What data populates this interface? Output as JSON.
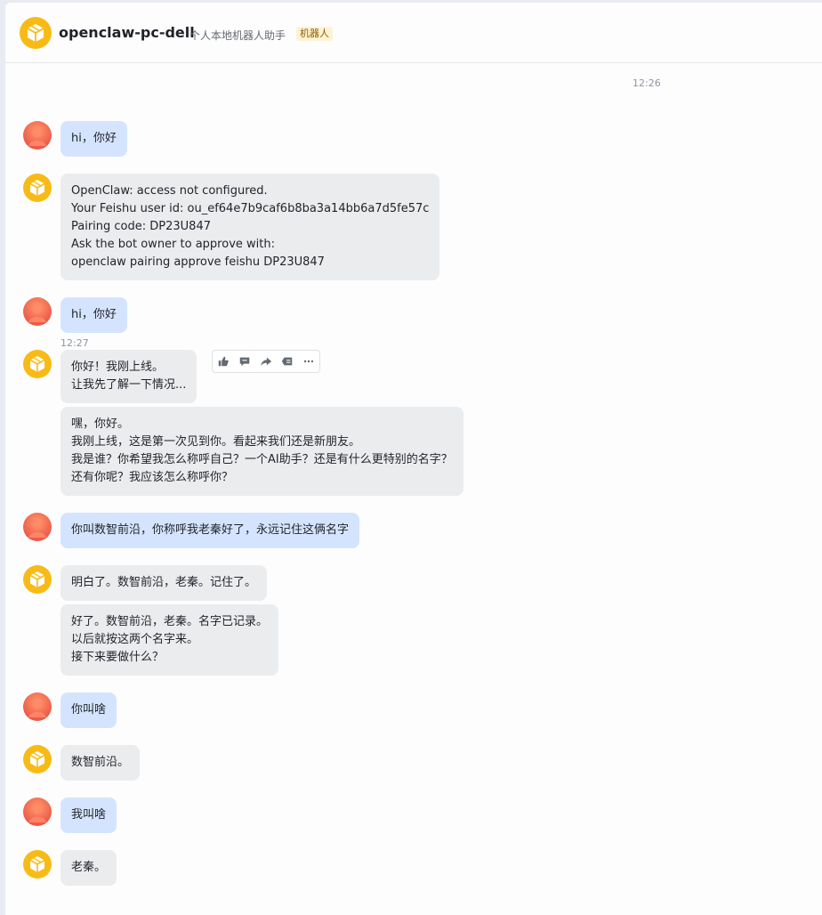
{
  "header": {
    "title": "openclaw-pc-dell",
    "subtitle": "个人本地机器人助手",
    "tag": "机器人"
  },
  "timestamps": [
    "12:26",
    "12:27"
  ],
  "messages": [
    {
      "sender": "user",
      "text": "hi，你好"
    },
    {
      "sender": "bot",
      "text": "OpenClaw: access not configured.\nYour Feishu user id: ou_ef64e7b9caf6b8ba3a14bb6a7d5fe57c\nPairing code: DP23U847\nAsk the bot owner to approve with:\nopenclaw pairing approve feishu DP23U847"
    },
    {
      "sender": "user",
      "text": "hi，你好"
    },
    {
      "sender": "bot",
      "text": "你好！我刚上线。\n让我先了解一下情况..."
    },
    {
      "sender": "bot",
      "text": "嘿，你好。\n我刚上线，这是第一次见到你。看起来我们还是新朋友。\n我是谁？你希望我怎么称呼自己？一个AI助手？还是有什么更特别的名字？\n还有你呢？我应该怎么称呼你？"
    },
    {
      "sender": "user",
      "text": "你叫数智前沿，你称呼我老秦好了，永远记住这俩名字"
    },
    {
      "sender": "bot",
      "text": "明白了。数智前沿，老秦。记住了。"
    },
    {
      "sender": "bot",
      "text": "好了。数智前沿，老秦。名字已记录。\n以后就按这两个名字来。\n接下来要做什么？"
    },
    {
      "sender": "user",
      "text": "你叫啥"
    },
    {
      "sender": "bot",
      "text": "数智前沿。"
    },
    {
      "sender": "user",
      "text": "我叫啥"
    },
    {
      "sender": "bot",
      "text": "老秦。"
    }
  ],
  "message_toolbar": {
    "icons": [
      "thumbs-up-icon",
      "comment-icon",
      "forward-icon",
      "quote-icon",
      "more-icon"
    ]
  },
  "colors": {
    "user_bubble": "#d5e4fe",
    "bot_bubble": "#ebecee",
    "bot_avatar": "#f8bb16",
    "user_avatar": "#f05a4a"
  }
}
